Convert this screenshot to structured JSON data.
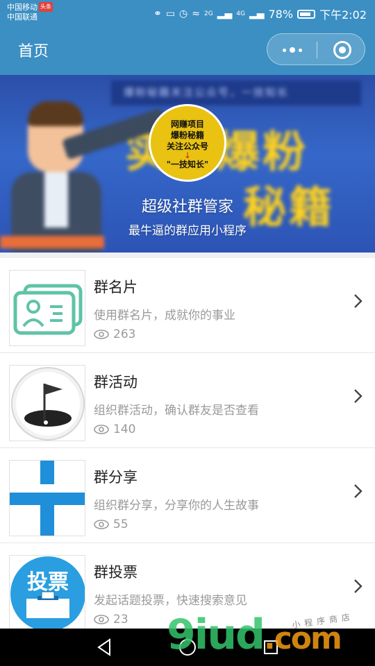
{
  "status_bar": {
    "carrier1": "中国移动",
    "carrier_badge": "头条",
    "carrier2": "中国联通",
    "network1": "2G",
    "network2": "4G",
    "battery": "78%",
    "time": "下午2:02"
  },
  "nav": {
    "title": "首页"
  },
  "banner": {
    "top_strip": "爆粉秘籍关注公众号，一技知长",
    "big_text_1": "实效爆粉",
    "big_text_2": "秘籍",
    "circle_line1": "网赚项目",
    "circle_line2": "爆粉秘籍",
    "circle_line3": "关注公众号",
    "circle_arrow": "↓",
    "circle_slogan": "\"一技知长\"",
    "title": "超级社群管家",
    "subtitle": "最牛逼的群应用小程序"
  },
  "items": [
    {
      "title": "群名片",
      "desc": "使用群名片，成就你的事业",
      "views": "263",
      "icon": "id-card-icon"
    },
    {
      "title": "群活动",
      "desc": "组织群活动，确认群友是否查看",
      "views": "140",
      "icon": "golf-flag-icon"
    },
    {
      "title": "群分享",
      "desc": "组织群分享，分享你的人生故事",
      "views": "55",
      "icon": "share-cross-icon"
    },
    {
      "title": "群投票",
      "desc": "发起话题投票，快速搜索意见",
      "views": "23",
      "icon": "ballot-box-icon",
      "thumb_text": "投票"
    }
  ],
  "watermark": {
    "brand": "9iud",
    "suffix": ".com",
    "small": "小程序商店"
  },
  "colors": {
    "header": "#3b8fc3",
    "teal_icon": "#5ec3a7",
    "blue_icon": "#1e8fd8",
    "vote_blue": "#2a9ee0"
  }
}
